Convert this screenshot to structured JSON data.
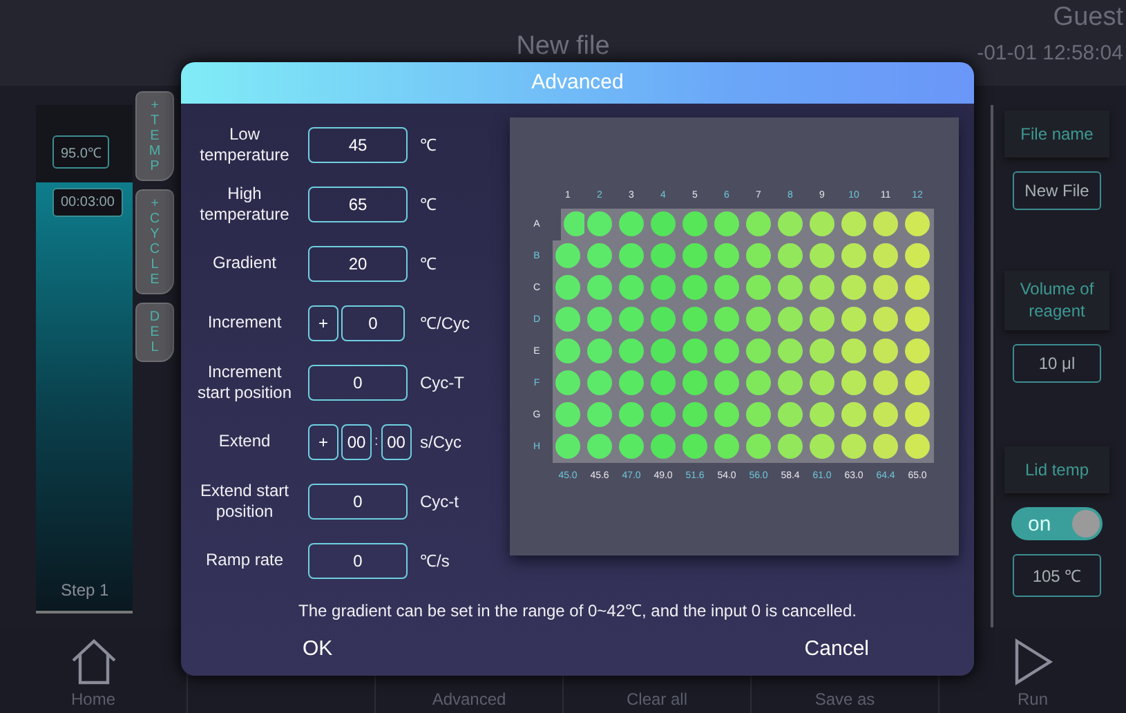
{
  "header": {
    "title": "New file",
    "user": "Guest",
    "datetime": "-01-01 12:58:04"
  },
  "step": {
    "temperature": "95.0℃",
    "time": "00:03:00",
    "label": "Step 1"
  },
  "side_tabs": [
    {
      "label": "+TEMP"
    },
    {
      "label": "+CYCLE"
    },
    {
      "label": "DEL"
    }
  ],
  "right_panel": {
    "file_name_label": "File name",
    "file_name": "New File",
    "volume_label": "Volume of reagent",
    "volume": "10 μl",
    "lid_label": "Lid temp",
    "lid_toggle": {
      "label": "on",
      "on": true
    },
    "lid_temp": "105 ℃"
  },
  "nav": [
    {
      "label": "Home",
      "kind": "home"
    },
    {
      "kind": "blank"
    },
    {
      "label": "Advanced",
      "kind": "text"
    },
    {
      "label": "Clear all",
      "kind": "text"
    },
    {
      "label": "Save as",
      "kind": "text"
    },
    {
      "label": "Run",
      "kind": "run"
    }
  ],
  "dialog": {
    "title": "Advanced",
    "fields": [
      {
        "label": "Low temperature",
        "kind": "single",
        "value": "45",
        "unit": "℃"
      },
      {
        "label": "High temperature",
        "kind": "single",
        "value": "65",
        "unit": "℃"
      },
      {
        "label": "Gradient",
        "kind": "single",
        "value": "20",
        "unit": "℃"
      },
      {
        "label": "Increment",
        "kind": "signed",
        "sign": "+",
        "value": "0",
        "unit": "℃/Cyc"
      },
      {
        "label": "Increment start position",
        "kind": "single",
        "value": "0",
        "unit": "Cyc-T"
      },
      {
        "label": "Extend",
        "kind": "time",
        "sign": "+",
        "values": [
          "00",
          "00"
        ],
        "separator": ":",
        "unit": "s/Cyc"
      },
      {
        "label": "Extend start position",
        "kind": "single",
        "value": "0",
        "unit": "Cyc-t"
      },
      {
        "label": "Ramp rate",
        "kind": "single",
        "value": "0",
        "unit": "℃/s"
      }
    ],
    "plate": {
      "rows": [
        "A",
        "B",
        "C",
        "D",
        "E",
        "F",
        "G",
        "H"
      ],
      "columns": [
        {
          "label": "1",
          "temp": "45.0",
          "color": "#5ee86a"
        },
        {
          "label": "2",
          "temp": "45.6",
          "color": "#5ce868"
        },
        {
          "label": "3",
          "temp": "47.0",
          "color": "#58e862"
        },
        {
          "label": "4",
          "temp": "49.0",
          "color": "#52e45a"
        },
        {
          "label": "5",
          "temp": "51.6",
          "color": "#56e658"
        },
        {
          "label": "6",
          "temp": "54.0",
          "color": "#66e85a"
        },
        {
          "label": "7",
          "temp": "56.0",
          "color": "#7ee85a"
        },
        {
          "label": "8",
          "temp": "58.4",
          "color": "#92e85a"
        },
        {
          "label": "9",
          "temp": "61.0",
          "color": "#a4e85a"
        },
        {
          "label": "10",
          "temp": "63.0",
          "color": "#b8e858"
        },
        {
          "label": "11",
          "temp": "64.4",
          "color": "#c6e658"
        },
        {
          "label": "12",
          "temp": "65.0",
          "color": "#cfe854"
        }
      ]
    },
    "note": "The gradient can be set in the range of 0~42℃, and the input 0 is cancelled.",
    "buttons": [
      "OK",
      "Cancel"
    ]
  }
}
